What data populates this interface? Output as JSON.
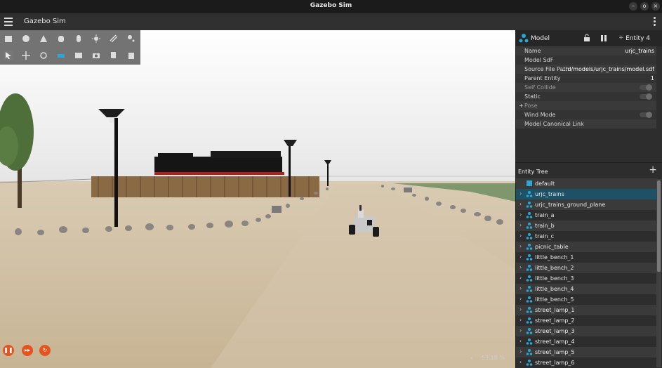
{
  "window": {
    "title": "Gazebo Sim",
    "minimize": "–",
    "maximize": "o",
    "close": "×"
  },
  "app": {
    "title": "Gazebo Sim"
  },
  "toolbar": {
    "row1": [
      "box-shape-icon",
      "sphere-shape-icon",
      "cone-shape-icon",
      "cylinder-shape-icon",
      "capsule-shape-icon",
      "sun-light-icon",
      "directional-light-icon",
      "spot-light-icon"
    ],
    "row2": [
      "select-tool-icon",
      "translate-tool-icon",
      "rotate-tool-icon",
      "grid-tool-icon",
      "screenshot-tool-icon",
      "camera-tool-icon",
      "copy-tool-icon",
      "paste-tool-icon"
    ]
  },
  "playback": {
    "play_pause": "❚❚",
    "step": "▸▸",
    "reset": "↻"
  },
  "rtf": {
    "arrow": "‹",
    "value": "53.18 %"
  },
  "component": {
    "label": "Model",
    "plus": "+",
    "entity": "Entity 4",
    "props": [
      {
        "key": "Name",
        "value": "urjc_trains"
      },
      {
        "key": "Model SdF",
        "value": ""
      },
      {
        "key": "Source File Path",
        "value": "...d/models/urjc_trains/model.sdf"
      },
      {
        "key": "Parent Entity",
        "value": "1"
      },
      {
        "key": "Self Collide",
        "value": "",
        "toggle": true
      },
      {
        "key": "Static",
        "value": "",
        "toggle": true
      },
      {
        "key": "Pose",
        "value": "",
        "expander": "+"
      },
      {
        "key": "Wind Mode",
        "value": "",
        "toggle": true
      },
      {
        "key": "Model Canonical Link",
        "value": ""
      }
    ]
  },
  "tree": {
    "title": "Entity Tree",
    "add": "+",
    "items": [
      {
        "name": "default",
        "chev": ""
      },
      {
        "name": "urjc_trains",
        "chev": "›",
        "selected": true
      },
      {
        "name": "urjc_trains_ground_plane",
        "chev": "›"
      },
      {
        "name": "train_a",
        "chev": "›"
      },
      {
        "name": "train_b",
        "chev": "›"
      },
      {
        "name": "train_c",
        "chev": "›"
      },
      {
        "name": "picnic_table",
        "chev": "›"
      },
      {
        "name": "little_bench_1",
        "chev": "›"
      },
      {
        "name": "little_bench_2",
        "chev": "›"
      },
      {
        "name": "little_bench_3",
        "chev": "›"
      },
      {
        "name": "little_bench_4",
        "chev": "›"
      },
      {
        "name": "little_bench_5",
        "chev": "›"
      },
      {
        "name": "street_lamp_1",
        "chev": "›"
      },
      {
        "name": "street_lamp_2",
        "chev": "›"
      },
      {
        "name": "street_lamp_3",
        "chev": "›"
      },
      {
        "name": "street_lamp_4",
        "chev": "›"
      },
      {
        "name": "street_lamp_5",
        "chev": "›"
      },
      {
        "name": "street_lamp_6",
        "chev": "›"
      }
    ]
  },
  "colors": {
    "accent": "#e8521e",
    "selected_row": "#1d5266",
    "entity_icon": "#2aa7d6"
  }
}
